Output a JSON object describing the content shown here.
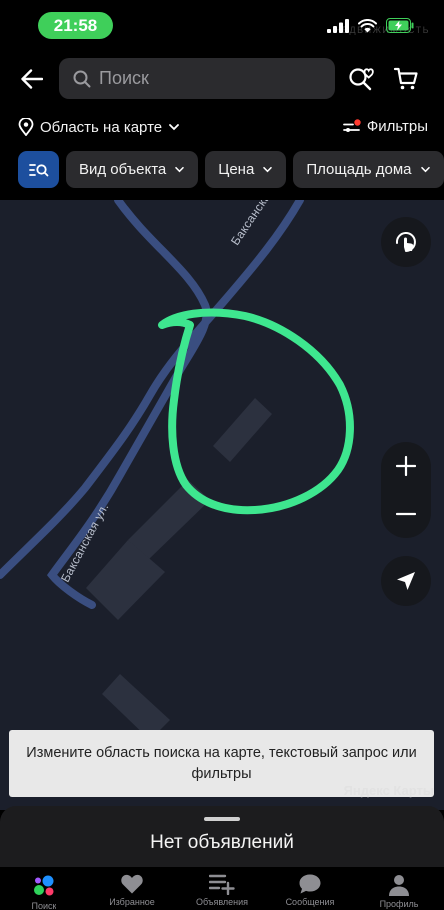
{
  "status_bar": {
    "time": "21:58",
    "battery_color": "#3fcf5a",
    "icons": [
      "signal-icon",
      "wifi-icon",
      "battery-charging-icon"
    ],
    "watermark_sub": "НЕДВИЖИМОСТЬ"
  },
  "header": {
    "search_placeholder": "Поиск",
    "region_label": "Область на карте",
    "filters_label": "Фильтры",
    "filters_badge_color": "#ff3b30",
    "chips": [
      {
        "label": "Вид объекта"
      },
      {
        "label": "Цена"
      },
      {
        "label": "Площадь дома"
      }
    ]
  },
  "map": {
    "street_labels": [
      "Баксанская ул.",
      "Баксанская ул."
    ],
    "drawn_area_color": "#3ee68f",
    "toast": "Измените область поиска на карте, текстовый запрос или фильтры",
    "attribution": "Яндекс Карты"
  },
  "sheet": {
    "title": "Нет объявлений"
  },
  "bottom_nav": {
    "items": [
      {
        "label": "Поиск",
        "icon": "app-logo-icon"
      },
      {
        "label": "Избранное",
        "icon": "heart-icon"
      },
      {
        "label": "Объявления",
        "icon": "add-listing-icon"
      },
      {
        "label": "Сообщения",
        "icon": "chat-icon"
      },
      {
        "label": "Профиль",
        "icon": "profile-icon"
      }
    ]
  }
}
